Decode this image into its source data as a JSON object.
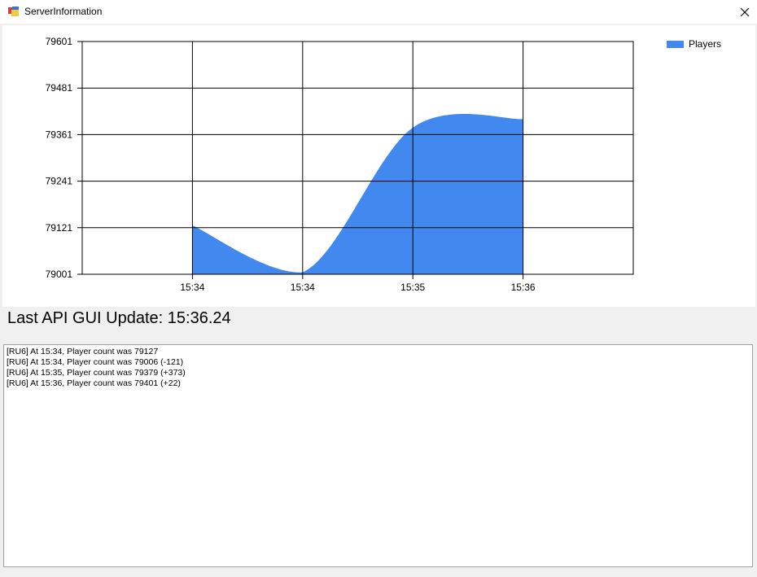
{
  "window": {
    "title": "ServerInformation",
    "close_glyph": "✕"
  },
  "chart_data": {
    "type": "area",
    "categories": [
      "15:34",
      "15:34",
      "15:35",
      "15:36"
    ],
    "series": [
      {
        "name": "Players",
        "values": [
          79127,
          79006,
          79379,
          79401
        ],
        "color": "#4189ee"
      }
    ],
    "y_ticks": [
      "79601",
      "79481",
      "79361",
      "79241",
      "79121",
      "79001"
    ],
    "ylim": [
      79001,
      79601
    ],
    "grid": true,
    "legend_position": "top-right"
  },
  "status": {
    "label": "Last API GUI Update: 15:36.24"
  },
  "log": {
    "lines": [
      "[RU6] At 15:34, Player count was 79127",
      "[RU6] At 15:34, Player count was 79006 (-121)",
      "[RU6] At 15:35, Player count was 79379 (+373)",
      "[RU6] At 15:36, Player count was 79401 (+22)"
    ]
  },
  "colors": {
    "series": "#4189ee",
    "grid": "#000000",
    "background": "#f0f0f0"
  }
}
